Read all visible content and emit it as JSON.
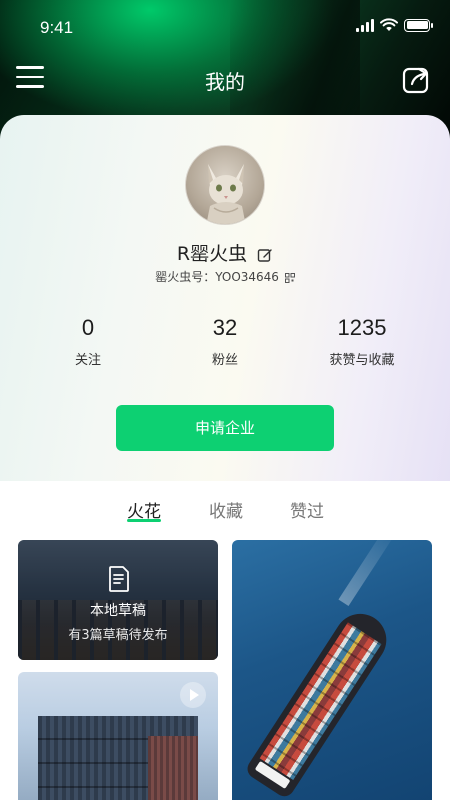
{
  "status_bar": {
    "time": "9:41"
  },
  "nav": {
    "title": "我的",
    "menu_icon": "menu-icon",
    "share_icon": "share-icon"
  },
  "profile": {
    "username": "R罂火虫",
    "user_id_label": "罂火虫号：YOO34646",
    "stats": [
      {
        "value": "0",
        "label": "关注"
      },
      {
        "value": "32",
        "label": "粉丝"
      },
      {
        "value": "1235",
        "label": "获赞与收藏"
      }
    ],
    "apply_button": "申请企业"
  },
  "tabs": [
    {
      "label": "火花",
      "active": true
    },
    {
      "label": "收藏",
      "active": false
    },
    {
      "label": "赞过",
      "active": false
    }
  ],
  "feed": {
    "draft": {
      "title": "本地草稿",
      "subtitle": "有3篇草稿待发布"
    }
  },
  "colors": {
    "accent": "#0dd072"
  }
}
